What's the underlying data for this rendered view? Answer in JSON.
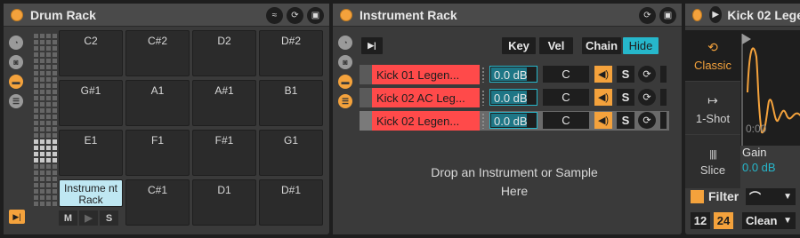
{
  "drum_rack": {
    "title": "Drum Rack",
    "pads": [
      [
        "C2",
        "C#2",
        "D2",
        "D#2"
      ],
      [
        "G#1",
        "A1",
        "A#1",
        "B1"
      ],
      [
        "E1",
        "F1",
        "F#1",
        "G1"
      ],
      [
        "Instrume nt Rack",
        "C#1",
        "D1",
        "D#1"
      ]
    ],
    "pad_controls": {
      "mute": "M",
      "play": "▶",
      "solo": "S"
    }
  },
  "instrument_rack": {
    "title": "Instrument Rack",
    "buttons": {
      "key": "Key",
      "vel": "Vel",
      "chain": "Chain",
      "hide": "Hide"
    },
    "chains": [
      {
        "name": "Kick 01 Legen...",
        "volume": "0.0 dB",
        "pan": "C",
        "solo": "S"
      },
      {
        "name": "Kick 02 AC Leg...",
        "volume": "0.0 dB",
        "pan": "C",
        "solo": "S"
      },
      {
        "name": "Kick 02 Legen...",
        "volume": "0.0 dB",
        "pan": "C",
        "solo": "S"
      }
    ],
    "drop_text_line1": "Drop an Instrument or Sample",
    "drop_text_line2": "Here"
  },
  "simpler": {
    "title": "Kick 02 Lege",
    "modes": [
      {
        "label": "Classic",
        "glyph": "⟲"
      },
      {
        "label": "1-Shot",
        "glyph": "↦"
      },
      {
        "label": "Slice",
        "glyph": "||||"
      }
    ],
    "time_label": "0:00",
    "gain_label": "Gain",
    "gain_value": "0.0 dB",
    "filter_label": "Filter",
    "filter_type": "⌒",
    "slope_12": "12",
    "slope_24": "24",
    "drive_mode": "Clean"
  },
  "colors": {
    "accent": "#f4a23c",
    "cyan": "#26b7cb",
    "chain_red": "#ff4a4a",
    "active_pad": "#bfe7f2"
  }
}
